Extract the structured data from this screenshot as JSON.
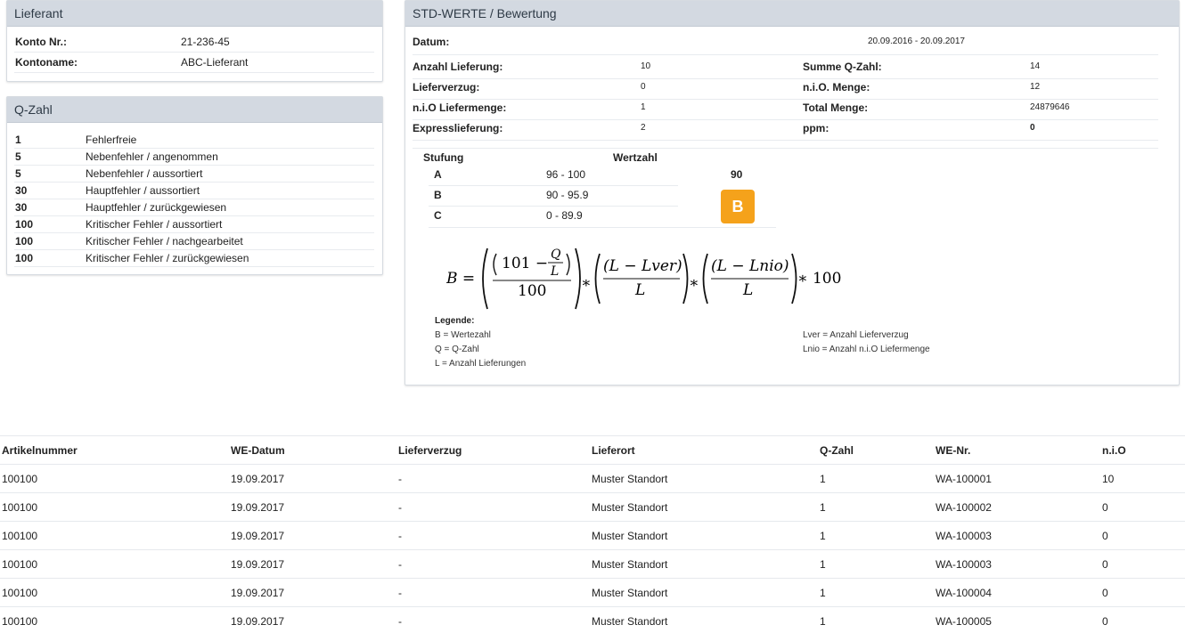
{
  "lieferant": {
    "title": "Lieferant",
    "rows": [
      {
        "label": "Konto Nr.:",
        "value": "21-236-45"
      },
      {
        "label": "Kontoname:",
        "value": "ABC-Lieferant"
      }
    ]
  },
  "qzahl": {
    "title": "Q-Zahl",
    "rows": [
      {
        "num": "1",
        "text": "Fehlerfreie"
      },
      {
        "num": "5",
        "text": "Nebenfehler / angenommen"
      },
      {
        "num": "5",
        "text": "Nebenfehler / aussortiert"
      },
      {
        "num": "30",
        "text": "Hauptfehler / aussortiert"
      },
      {
        "num": "30",
        "text": "Hauptfehler / zurückgewiesen"
      },
      {
        "num": "100",
        "text": "Kritischer Fehler / aussortiert"
      },
      {
        "num": "100",
        "text": "Kritischer Fehler / nachgearbeitet"
      },
      {
        "num": "100",
        "text": "Kritischer Fehler / zurückgewiesen"
      }
    ]
  },
  "std": {
    "title": "STD-WERTE / Bewertung",
    "datum_label": "Datum:",
    "datum_value": "20.09.2016 - 20.09.2017",
    "left": [
      {
        "label": "Anzahl Lieferung:",
        "value": "10"
      },
      {
        "label": "Lieferverzug:",
        "value": "0"
      },
      {
        "label": "n.i.O Liefermenge:",
        "value": "1"
      },
      {
        "label": "Expresslieferung:",
        "value": "2"
      }
    ],
    "right": [
      {
        "label": "Summe Q-Zahl:",
        "value": "14"
      },
      {
        "label": "n.i.O. Menge:",
        "value": "12"
      },
      {
        "label": "Total Menge:",
        "value": "24879646"
      },
      {
        "label": "ppm:",
        "value": "0"
      }
    ],
    "stufung_header": "Stufung",
    "wertzahl_header": "Wertzahl",
    "stufen": [
      {
        "grade": "A",
        "range": "96 - 100"
      },
      {
        "grade": "B",
        "range": "90 - 95.9"
      },
      {
        "grade": "C",
        "range": "0 - 89.9"
      }
    ],
    "wertzahl_value": "90",
    "grade_badge": "B",
    "badge_color": "#f5a21b",
    "formula": {
      "lhs": "B =",
      "n101": "101 −",
      "q": "Q",
      "l": "L",
      "d100": "100",
      "times1": "∗",
      "num2": "(L − Lver)",
      "den2": "L",
      "times2": "∗",
      "num3": "(L − Lnio)",
      "den3": "L",
      "tail": "∗ 100"
    },
    "legend_title": "Legende:",
    "legend_left": [
      "B = Wertezahl",
      "Q = Q-Zahl",
      "L = Anzahl Lieferungen"
    ],
    "legend_right": [
      "Lver = Anzahl Lieferverzug",
      "Lnio = Anzahl n.i.O Liefermenge"
    ]
  },
  "table": {
    "headers": [
      "Artikelnummer",
      "WE-Datum",
      "Lieferverzug",
      "Lieferort",
      "Q-Zahl",
      "WE-Nr.",
      "n.i.O"
    ],
    "rows": [
      [
        "100100",
        "19.09.2017",
        "-",
        "Muster Standort",
        "1",
        "WA-100001",
        "10"
      ],
      [
        "100100",
        "19.09.2017",
        "-",
        "Muster Standort",
        "1",
        "WA-100002",
        "0"
      ],
      [
        "100100",
        "19.09.2017",
        "-",
        "Muster Standort",
        "1",
        "WA-100003",
        "0"
      ],
      [
        "100100",
        "19.09.2017",
        "-",
        "Muster Standort",
        "1",
        "WA-100003",
        "0"
      ],
      [
        "100100",
        "19.09.2017",
        "-",
        "Muster Standort",
        "1",
        "WA-100004",
        "0"
      ],
      [
        "100100",
        "19.09.2017",
        "-",
        "Muster Standort",
        "1",
        "WA-100005",
        "0"
      ]
    ]
  }
}
